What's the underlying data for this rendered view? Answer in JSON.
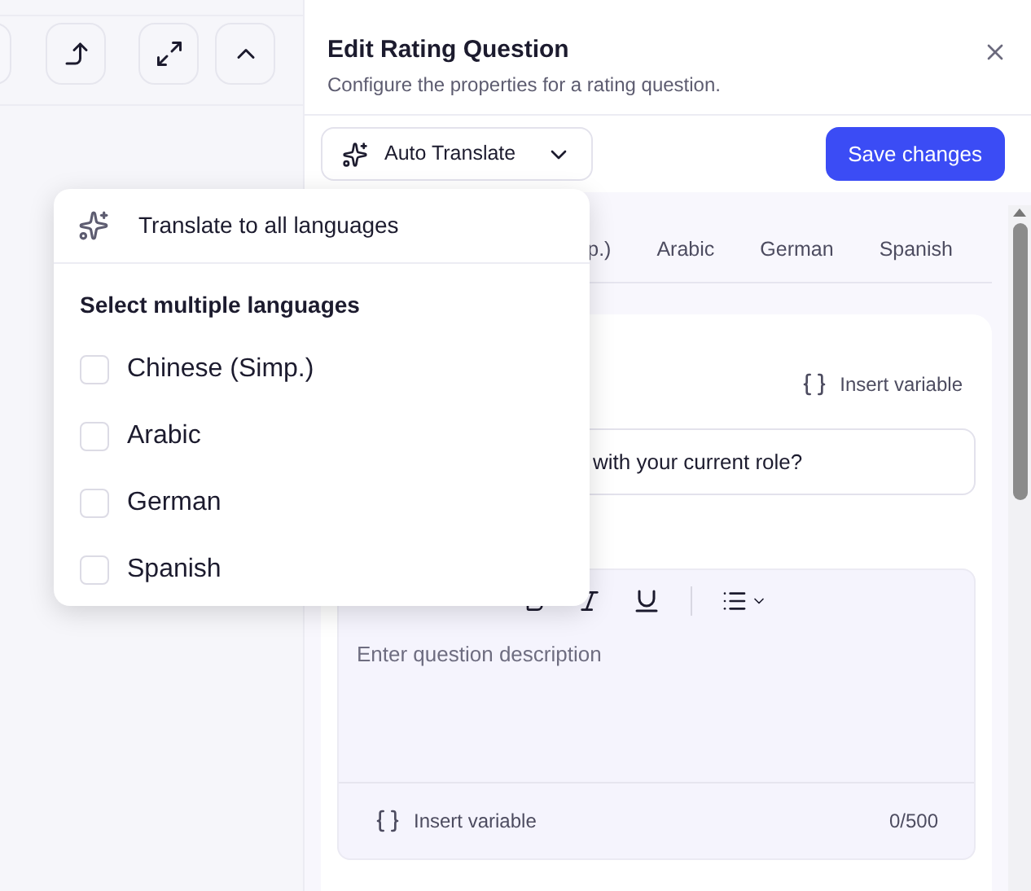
{
  "panel": {
    "title": "Edit Rating Question",
    "subtitle": "Configure the properties for a rating question.",
    "translate_button": "Auto Translate",
    "save_button": "Save changes"
  },
  "language_tabs": [
    {
      "label": "p.)"
    },
    {
      "label": "Arabic"
    },
    {
      "label": "German"
    },
    {
      "label": "Spanish"
    }
  ],
  "question": {
    "insert_variable": "Insert variable",
    "value": "with your current role?"
  },
  "description": {
    "placeholder": "Enter question description",
    "insert_variable": "Insert variable",
    "counter": "0/500"
  },
  "translate_menu": {
    "all_option": "Translate to all languages",
    "heading": "Select multiple languages",
    "languages": [
      {
        "label": "Chinese (Simp.)",
        "checked": false
      },
      {
        "label": "Arabic",
        "checked": false
      },
      {
        "label": "German",
        "checked": false
      },
      {
        "label": "Spanish",
        "checked": false
      }
    ]
  }
}
